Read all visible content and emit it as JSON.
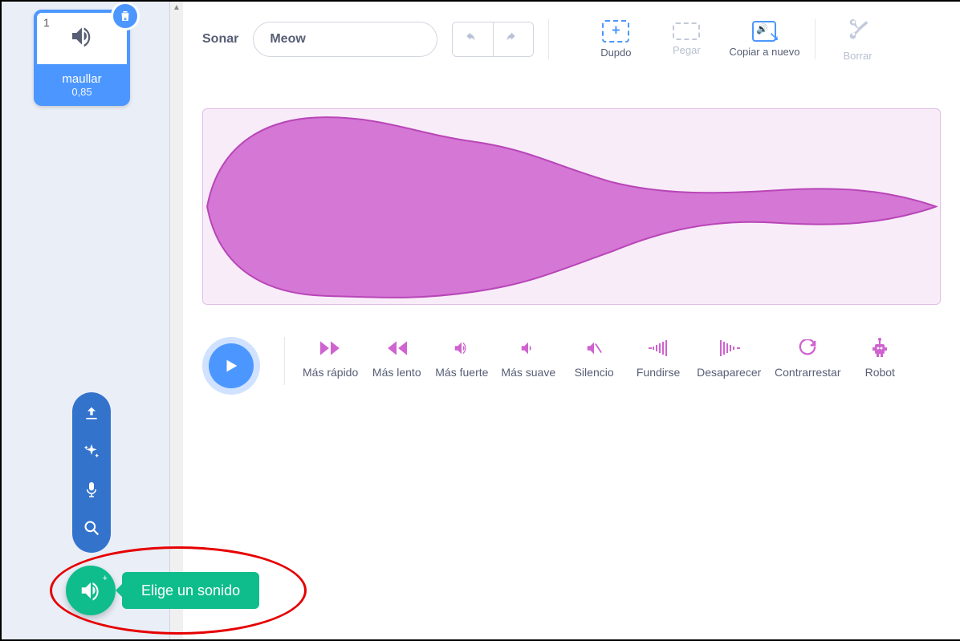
{
  "sidebar": {
    "sound_card": {
      "index": "1",
      "name": "maullar",
      "duration": "0,85"
    }
  },
  "toolbar": {
    "label": "Sonar",
    "sound_name": "Meow",
    "tools": {
      "dupdo": "Dupdo",
      "pegar": "Pegar",
      "copiar": "Copiar a nuevo",
      "borrar": "Borrar"
    }
  },
  "effects": {
    "faster": "Más rápido",
    "slower": "Más lento",
    "louder": "Más fuerte",
    "softer": "Más suave",
    "mute": "Silencio",
    "fade_in": "Fundirse",
    "fade_out": "Desaparecer",
    "reverse": "Contrarrestar",
    "robot": "Robot"
  },
  "fab": {
    "tooltip": "Elige un sonido"
  }
}
